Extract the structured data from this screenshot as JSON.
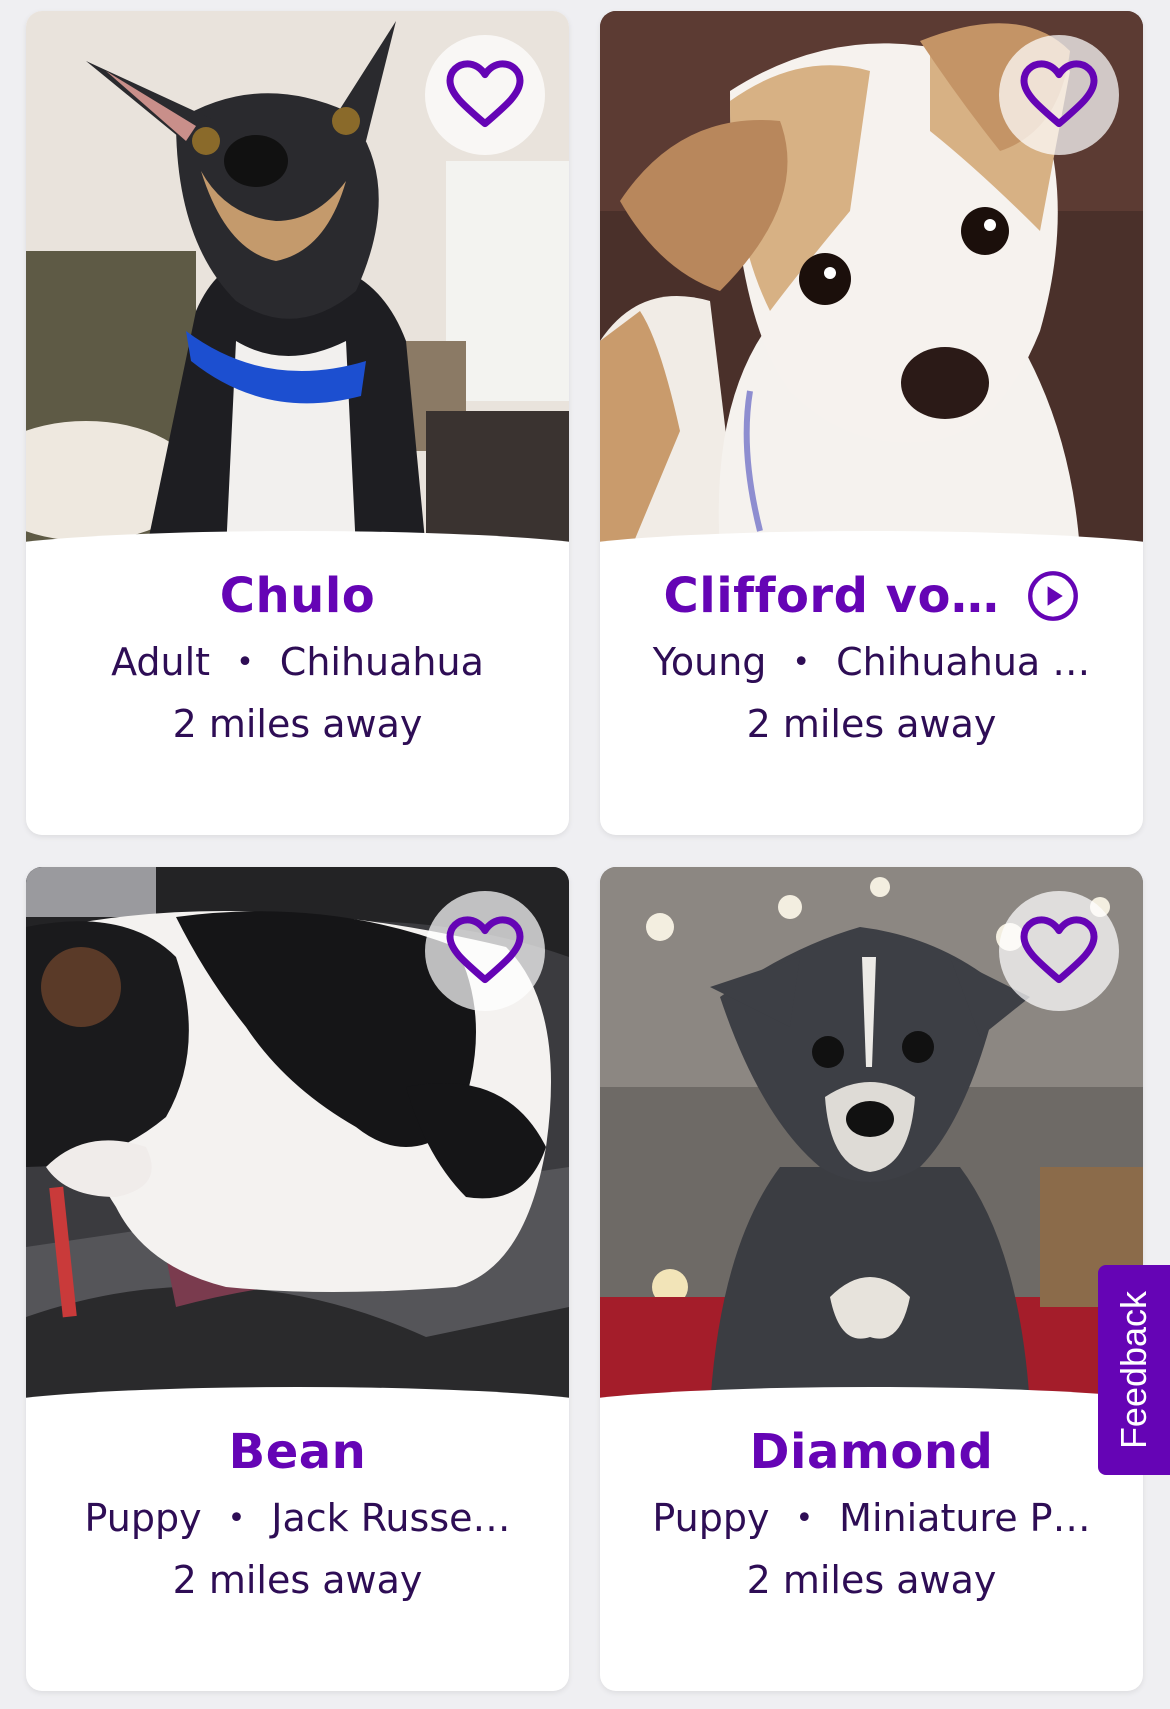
{
  "colors": {
    "accent": "#6504b5",
    "text": "#2e0d55",
    "background": "#efeff2"
  },
  "cards": [
    {
      "name": "Chulo",
      "age": "Adult",
      "breed": "Chihuahua",
      "distance": "2 miles away",
      "has_video": false,
      "photo": "dog-photo-black-tan-chihuahua-blue-collar"
    },
    {
      "name": "Clifford vo…",
      "age": "Young",
      "breed": "Chihuahua …",
      "distance": "2 miles away",
      "has_video": true,
      "photo": "dog-photo-white-tan-terrier"
    },
    {
      "name": "Bean",
      "age": "Puppy",
      "breed": "Jack Russe…",
      "distance": "2 miles away",
      "has_video": false,
      "photo": "dog-photo-black-white-puppy-blanket"
    },
    {
      "name": "Diamond",
      "age": "Puppy",
      "breed": "Miniature P…",
      "distance": "2 miles away",
      "has_video": false,
      "photo": "dog-photo-gray-puppy-holiday"
    }
  ],
  "separator": "•",
  "icons": {
    "favorite": "heart-icon",
    "video": "play-circle-icon"
  },
  "feedback_label": "Feedback"
}
